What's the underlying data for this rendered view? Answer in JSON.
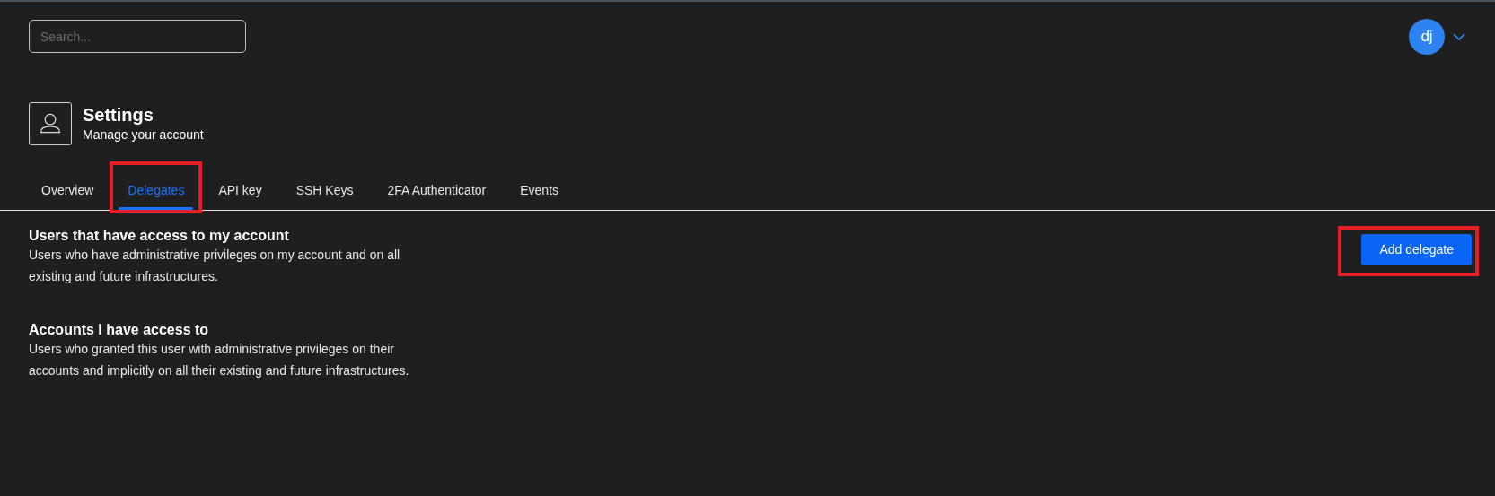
{
  "search": {
    "placeholder": "Search..."
  },
  "user": {
    "initials": "dj"
  },
  "header": {
    "title": "Settings",
    "subtitle": "Manage your account"
  },
  "tabs": [
    {
      "label": "Overview",
      "selected": false,
      "highlighted": false
    },
    {
      "label": "Delegates",
      "selected": true,
      "highlighted": true
    },
    {
      "label": "API key",
      "selected": false,
      "highlighted": false
    },
    {
      "label": "SSH Keys",
      "selected": false,
      "highlighted": false
    },
    {
      "label": "2FA Authenticator",
      "selected": false,
      "highlighted": false
    },
    {
      "label": "Events",
      "selected": false,
      "highlighted": false
    }
  ],
  "sections": [
    {
      "title": "Users that have access to my account",
      "description": "Users who have administrative privileges on my account and on all existing and future infrastructures.",
      "button": {
        "label": "Add delegate",
        "highlighted": true
      }
    },
    {
      "title": "Accounts I have access to",
      "description": "Users who granted this user with administrative privileges on their accounts and implicitly on all their existing and future infrastructures."
    }
  ]
}
